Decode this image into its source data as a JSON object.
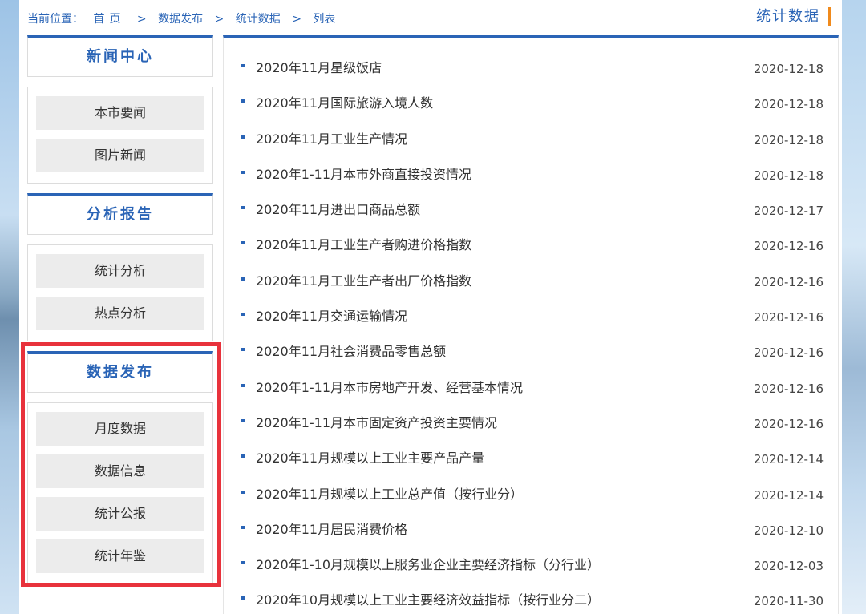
{
  "breadcrumb": {
    "label": "当前位置：",
    "items": [
      "首页",
      "数据发布",
      "统计数据",
      "列表"
    ],
    "sep": ">"
  },
  "section_title": "统计数据",
  "sidebar": {
    "groups": [
      {
        "title": "新闻中心",
        "items": [
          "本市要闻",
          "图片新闻"
        ]
      },
      {
        "title": "分析报告",
        "items": [
          "统计分析",
          "热点分析"
        ]
      },
      {
        "title": "数据发布",
        "items": [
          "月度数据",
          "数据信息",
          "统计公报",
          "统计年鉴"
        ]
      }
    ]
  },
  "articles": [
    {
      "title": "2020年11月星级饭店",
      "date": "2020-12-18"
    },
    {
      "title": "2020年11月国际旅游入境人数",
      "date": "2020-12-18"
    },
    {
      "title": "2020年11月工业生产情况",
      "date": "2020-12-18"
    },
    {
      "title": "2020年1-11月本市外商直接投资情况",
      "date": "2020-12-18"
    },
    {
      "title": "2020年11月进出口商品总额",
      "date": "2020-12-17"
    },
    {
      "title": "2020年11月工业生产者购进价格指数",
      "date": "2020-12-16"
    },
    {
      "title": "2020年11月工业生产者出厂价格指数",
      "date": "2020-12-16"
    },
    {
      "title": "2020年11月交通运输情况",
      "date": "2020-12-16"
    },
    {
      "title": "2020年11月社会消费品零售总额",
      "date": "2020-12-16"
    },
    {
      "title": "2020年1-11月本市房地产开发、经营基本情况",
      "date": "2020-12-16"
    },
    {
      "title": "2020年1-11月本市固定资产投资主要情况",
      "date": "2020-12-16"
    },
    {
      "title": "2020年11月规模以上工业主要产品产量",
      "date": "2020-12-14"
    },
    {
      "title": "2020年11月规模以上工业总产值（按行业分）",
      "date": "2020-12-14"
    },
    {
      "title": "2020年11月居民消费价格",
      "date": "2020-12-10"
    },
    {
      "title": "2020年1-10月规模以上服务业企业主要经济指标（分行业）",
      "date": "2020-12-03"
    },
    {
      "title": "2020年10月规模以上工业主要经济效益指标（按行业分二）",
      "date": "2020-11-30"
    }
  ],
  "colors": {
    "accent": "#2a64b6",
    "highlight": "#e8323c",
    "title_bar": "#f08a1c"
  }
}
